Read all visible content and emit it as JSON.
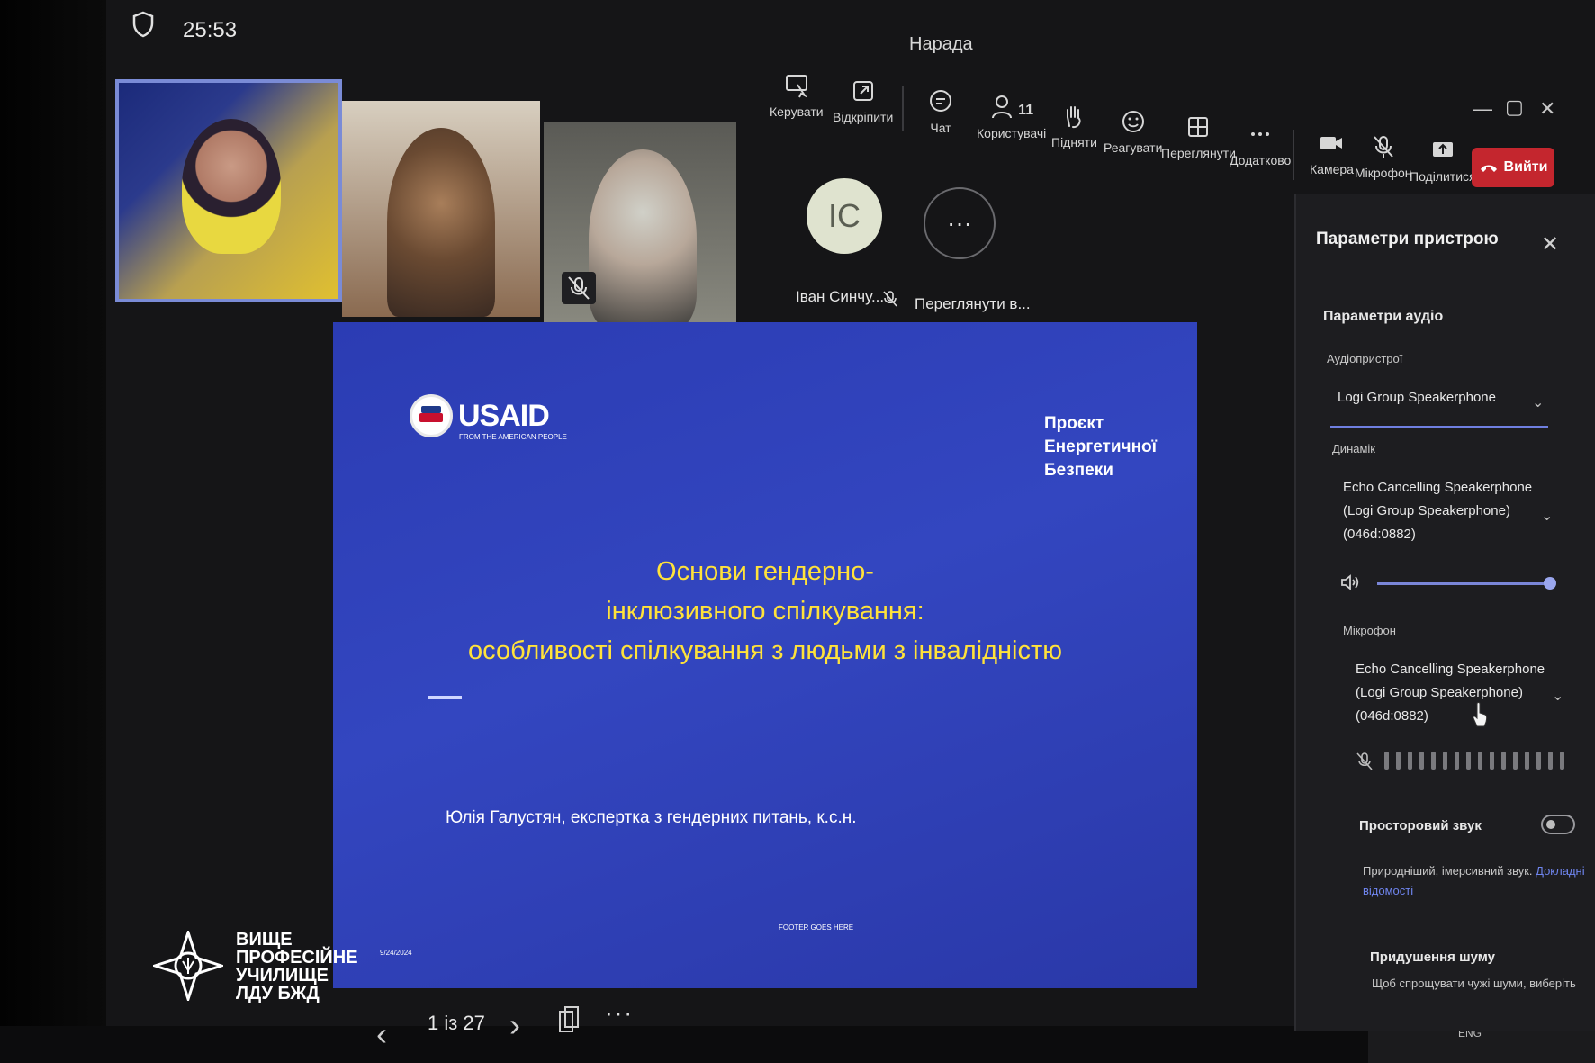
{
  "topbar": {
    "timer": "25:53",
    "meeting_title": "Нарада"
  },
  "toolbar": {
    "control": "Керувати",
    "popout": "Відкріпити",
    "chat": "Чат",
    "people": "Користувачі",
    "people_count": "11",
    "raise": "Підняти",
    "react": "Реагувати",
    "view": "Переглянути",
    "more": "Додатково",
    "camera": "Камера",
    "mic": "Мікрофон",
    "share": "Поділитися",
    "leave": "Вийти"
  },
  "participants": {
    "initials": "ІС",
    "name1": "Іван Синчу...",
    "view_all": "Переглянути в...",
    "more_glyph": "···"
  },
  "slide": {
    "logo_text": "USAID",
    "logo_tagline": "FROM THE AMERICAN PEOPLE",
    "project_line1": "Проєкт",
    "project_line2": "Енергетичної",
    "project_line3": "Безпеки",
    "title_line1": "Основи гендерно-",
    "title_line2": "інклюзивного спілкування:",
    "title_line3": "особливості спілкування з людьми з інвалідністю",
    "author": "Юлія Галустян, експертка з гендерних питань, к.с.н.",
    "footer": "FOOTER GOES HERE",
    "date": "9/24/2024"
  },
  "slide_nav": {
    "page_indicator": "1 із 27",
    "more": "···"
  },
  "settings_panel": {
    "title": "Параметри пристрою",
    "audio_section": "Параметри аудіо",
    "audio_device_label": "Аудіопристрої",
    "audio_device_value": "Logi Group Speakerphone",
    "speaker_label": "Динамік",
    "speaker_line1": "Echo Cancelling Speakerphone",
    "speaker_line2": "(Logi Group Speakerphone)",
    "speaker_line3": "(046d:0882)",
    "speaker_volume": 1.0,
    "mic_label": "Мікрофон",
    "mic_line1": "Echo Cancelling Speakerphone",
    "mic_line2": "(Logi Group Speakerphone)",
    "mic_line3": "(046d:0882)",
    "spatial_label": "Просторовий звук",
    "spatial_desc": "Природніший, імерсивний звук.",
    "spatial_link1": "Докладні",
    "spatial_link2": "відомості",
    "noise_label": "Придушення шуму",
    "noise_desc": "Щоб спрощувати чужі шуми, виберіть"
  },
  "watermark": {
    "line1": "ВИЩЕ",
    "line2": "ПРОФЕСІЙНЕ",
    "line3": "УЧИЛИЩЕ",
    "line4": "ЛДУ БЖД"
  },
  "taskbar": {
    "lang": "ENG"
  },
  "colors": {
    "slide_bg": "#2f41b8",
    "slide_title": "#ffe23a",
    "leave_red": "#c4262e",
    "accent": "#6f7fe0"
  }
}
